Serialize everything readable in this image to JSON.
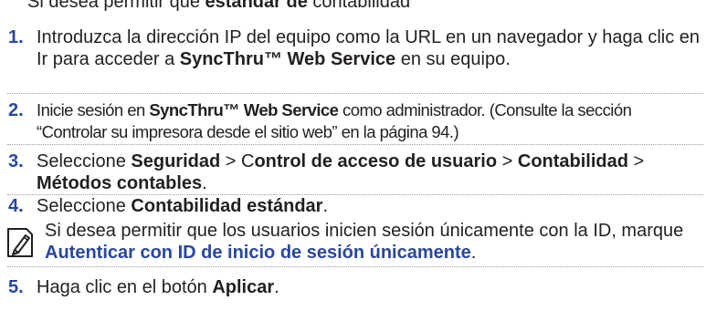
{
  "header_fragment": {
    "prefix": "Si desea permitir que ",
    "middle": "estándar de",
    "suffix": " contabilidad"
  },
  "steps": [
    {
      "number": "1.",
      "parts": [
        "Introduzca la dirección IP del equipo como la URL en un navegador y haga clic en Ir para acceder a ",
        "SyncThru™ Web Service",
        " en su equipo."
      ]
    },
    {
      "number": "2.",
      "parts": [
        "Inicie sesión en ",
        "SyncThru™ Web Service",
        " como administrador. (Consulte la sección “Controlar su impresora desde el sitio web” en la página 94.)"
      ]
    },
    {
      "number": "3.",
      "parts": [
        "Seleccione ",
        "Seguridad",
        " > C",
        "ontrol de acceso de usuario",
        " > ",
        "Contabilidad",
        " > ",
        "Métodos contables",
        "."
      ]
    },
    {
      "number": "4.",
      "parts": [
        "Seleccione ",
        "Contabilidad estándar",
        "."
      ]
    },
    {
      "number": "5.",
      "parts": [
        "Haga clic en el botón ",
        "Aplicar",
        "."
      ]
    }
  ],
  "note": {
    "icon": "note-pencil-icon",
    "parts": [
      "Si desea permitir que los usuarios inicien sesión únicamente con la ID, marque ",
      "Autenticar con ID de inicio de sesión únicamente",
      "."
    ]
  },
  "colors": {
    "number": "#29479b",
    "text": "#231f20",
    "rule": "#9a9a9a"
  }
}
